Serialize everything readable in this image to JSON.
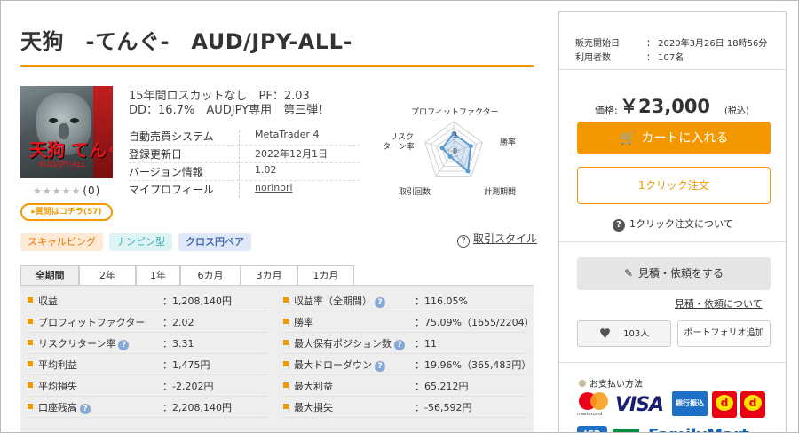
{
  "product": {
    "title": "天狗　-てんぐ-　AUD/JPY-ALL-",
    "image_caption": "天狗 てんぐ",
    "image_sub": "AUD/JPY-ALL",
    "stars": "★★★★★",
    "review_count": "(0)",
    "ask_button": "▸質問はコチラ(57)",
    "desc_line1": "15年間ロスカットなし　PF：2.03",
    "desc_line2": "DD：16.7%　AUDJPY専用　第三弾！"
  },
  "info": [
    {
      "key": "自動売買システム",
      "value": "MetaTrader 4"
    },
    {
      "key": "登録更新日",
      "value": "2022年12月1日"
    },
    {
      "key": "バージョン情報",
      "value": "1.02"
    },
    {
      "key": "マイプロフィール",
      "value": "norinori"
    }
  ],
  "radar": {
    "labels": [
      "プロフィットファクター",
      "勝率",
      "計測期間",
      "取引回数",
      "リスク\nターン率"
    ],
    "label_top": "プロフィットファクター",
    "label_right": "勝率",
    "label_bottom_right": "計測期間",
    "label_bottom_left": "取引回数",
    "label_left_1": "リスク",
    "label_left_2": "ターン率",
    "scale_3": "3",
    "scale_0": "0",
    "values": [
      3,
      3,
      4,
      1,
      2
    ],
    "max": 5,
    "color": "#5b9bd5"
  },
  "tags": [
    "スキャルピング",
    "ナンピン型",
    "クロス円ペア"
  ],
  "style_link": "取引スタイル",
  "tabs": [
    "全期間",
    "2年",
    "1年",
    "6カ月",
    "3カ月",
    "1カ月"
  ],
  "active_tab": "全期間",
  "stats_left": [
    {
      "label": "収益",
      "value": "：1,208,140円",
      "help": false
    },
    {
      "label": "プロフィットファクター",
      "value": "：2.02",
      "help": false
    },
    {
      "label": "リスクリターン率",
      "value": "：3.31",
      "help": true
    },
    {
      "label": "平均利益",
      "value": "：1,475円",
      "help": false
    },
    {
      "label": "平均損失",
      "value": "：-2,202円",
      "help": false
    },
    {
      "label": "口座残高",
      "value": "：2,208,140円",
      "help": true
    }
  ],
  "stats_right": [
    {
      "label": "収益率（全期間）",
      "value": "：116.05%",
      "help": true
    },
    {
      "label": "勝率",
      "value": "：75.09%（1655/2204）",
      "help": false
    },
    {
      "label": "最大保有ポジション数",
      "value": "：11",
      "help": true
    },
    {
      "label": "最大ドローダウン",
      "value": "：19.96%（365,483円）",
      "help": true
    },
    {
      "label": "最大利益",
      "value": "：65,212円",
      "help": false
    },
    {
      "label": "最大損失",
      "value": "：-56,592円",
      "help": false
    }
  ],
  "panel": {
    "sale_start_label": "販売開始日",
    "sale_start_value": "：  2020年3月26日 18時56分",
    "users_label": "利用者数",
    "users_value": "：  107名",
    "price_label": "価格:",
    "price_value": "￥23,000",
    "price_tax": "(税込)",
    "cart_button": "カートに入れる",
    "oneclick_button": "1クリック注文",
    "oneclick_about": "1クリック注文について",
    "quote_button": "見積・依頼をする",
    "quote_link": "見積・依頼について",
    "favorite_count": "103人",
    "portfolio_button": "ポートフォリオ追加",
    "payment_title": "お支払い方法",
    "pay_mastercard": "mastercard",
    "pay_visa": "VISA",
    "pay_bank": "銀行振込",
    "pay_d": "d",
    "pay_jcb": "JCB",
    "pay_famima": "FamilyMart"
  },
  "colors": {
    "accent": "#f39800",
    "tag_scalping_bg": "#fde9d4",
    "tag_nanpin_bg": "#ddf3f4",
    "tag_cross_bg": "#dfe8f6"
  }
}
